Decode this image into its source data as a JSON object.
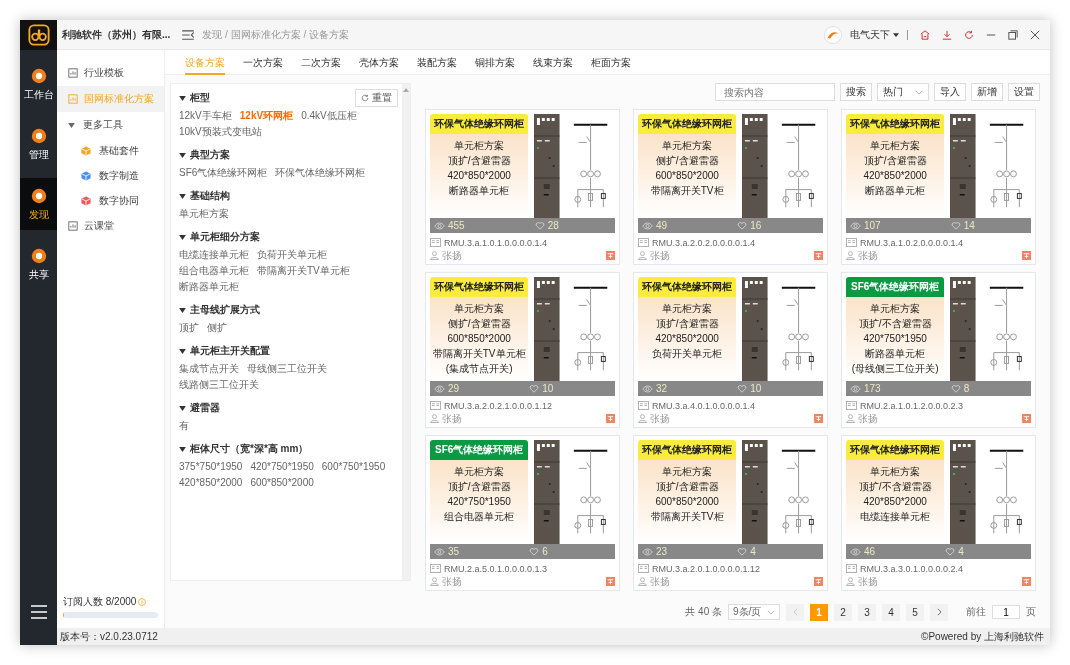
{
  "rail": {
    "items": [
      {
        "label": "工作台",
        "selected": false
      },
      {
        "label": "管理",
        "selected": false
      },
      {
        "label": "发现",
        "selected": true
      },
      {
        "label": "共享",
        "selected": false
      }
    ]
  },
  "app_title": "利驰软件（苏州）有限...",
  "breadcrumb": "发现 / 国网标准化方案 / 设备方案",
  "user": {
    "name": "电气天下"
  },
  "menu": {
    "items": [
      {
        "label": "行业模板",
        "selected": false
      },
      {
        "label": "国网标准化方案",
        "selected": true
      },
      {
        "label": "更多工具",
        "selected": false,
        "expanded": true,
        "children": [
          {
            "label": "基础套件",
            "color": "#f5a623"
          },
          {
            "label": "数字制造",
            "color": "#4a8ef0"
          },
          {
            "label": "数字协同",
            "color": "#f05a5a"
          }
        ]
      },
      {
        "label": "云课堂",
        "selected": false
      }
    ]
  },
  "subscription": {
    "label": "订阅人数 8/2000",
    "level": 0.004
  },
  "version": "版本号：v2.0.23.0712",
  "tabs": [
    {
      "label": "设备方案",
      "selected": true
    },
    {
      "label": "一次方案",
      "selected": false
    },
    {
      "label": "二次方案",
      "selected": false
    },
    {
      "label": "壳体方案",
      "selected": false
    },
    {
      "label": "装配方案",
      "selected": false
    },
    {
      "label": "铜排方案",
      "selected": false
    },
    {
      "label": "线束方案",
      "selected": false
    },
    {
      "label": "柜面方案",
      "selected": false
    }
  ],
  "filters": {
    "reset": "重置",
    "groups": [
      {
        "title": "柜型",
        "options": [
          {
            "label": "12kV手车柜",
            "selected": false
          },
          {
            "label": "12kV环网柜",
            "selected": true
          },
          {
            "label": "0.4kV低压柜",
            "selected": false
          },
          {
            "label": "10kV预装式变电站",
            "selected": false
          }
        ]
      },
      {
        "title": "典型方案",
        "options": [
          {
            "label": "SF6气体绝缘环网柜",
            "selected": false
          },
          {
            "label": "环保气体绝缘环网柜",
            "selected": false
          }
        ]
      },
      {
        "title": "基础结构",
        "options": [
          {
            "label": "单元柜方案",
            "selected": false
          }
        ]
      },
      {
        "title": "单元柜细分方案",
        "options": [
          {
            "label": "电缆连接单元柜",
            "selected": false
          },
          {
            "label": "负荷开关单元柜",
            "selected": false
          },
          {
            "label": "组合电器单元柜",
            "selected": false
          },
          {
            "label": "带隔离开关TV单元柜",
            "selected": false
          },
          {
            "label": "断路器单元柜",
            "selected": false
          }
        ]
      },
      {
        "title": "主母线扩展方式",
        "options": [
          {
            "label": "顶扩",
            "selected": false
          },
          {
            "label": "侧扩",
            "selected": false
          }
        ]
      },
      {
        "title": "单元柜主开关配置",
        "options": [
          {
            "label": "集成节点开关",
            "selected": false
          },
          {
            "label": "母线侧三工位开关",
            "selected": false
          },
          {
            "label": "线路侧三工位开关",
            "selected": false
          }
        ]
      },
      {
        "title": "避雷器",
        "options": [
          {
            "label": "有",
            "selected": false
          }
        ]
      },
      {
        "title": "柜体尺寸（宽*深*高 mm）",
        "options": [
          {
            "label": "375*750*1950",
            "selected": false
          },
          {
            "label": "420*750*1950",
            "selected": false
          },
          {
            "label": "600*750*1950",
            "selected": false
          },
          {
            "label": "420*850*2000",
            "selected": false
          },
          {
            "label": "600*850*2000",
            "selected": false
          }
        ]
      }
    ]
  },
  "toolbar": {
    "search_placeholder": "搜索内容",
    "search_button": "搜索",
    "sort": "热门",
    "buttons": [
      "导入",
      "新增",
      "设置"
    ]
  },
  "cards": [
    {
      "title": "环保气体绝缘环网柜",
      "color": "#f9ec3c",
      "lines": [
        "单元柜方案",
        "顶扩/含避雷器",
        "420*850*2000",
        "断路器单元柜"
      ],
      "views": "455",
      "likes": "28",
      "code": "RMU.3.a.1.0.1.0.0.0.0.1.4",
      "author": "张扬"
    },
    {
      "title": "环保气体绝缘环网柜",
      "color": "#f9ec3c",
      "lines": [
        "单元柜方案",
        "侧扩/含避雷器",
        "600*850*2000",
        "带隔离开关TV柜"
      ],
      "views": "49",
      "likes": "16",
      "code": "RMU.3.a.2.0.2.0.0.0.0.1.4",
      "author": "张扬"
    },
    {
      "title": "环保气体绝缘环网柜",
      "color": "#f9ec3c",
      "lines": [
        "单元柜方案",
        "顶扩/含避雷器",
        "420*850*2000",
        "断路器单元柜"
      ],
      "views": "107",
      "likes": "14",
      "code": "RMU.3.a.1.0.2.0.0.0.0.1.4",
      "author": "张扬"
    },
    {
      "title": "环保气体绝缘环网柜",
      "color": "#f9ec3c",
      "lines": [
        "单元柜方案",
        "侧扩/含避雷器",
        "600*850*2000",
        "带隔离开关TV单元柜",
        "(集成节点开关)"
      ],
      "views": "29",
      "likes": "10",
      "code": "RMU.3.a.2.0.2.1.0.0.0.1.12",
      "author": "张扬"
    },
    {
      "title": "环保气体绝缘环网柜",
      "color": "#f9ec3c",
      "lines": [
        "单元柜方案",
        "顶扩/含避雷器",
        "420*850*2000",
        "负荷开关单元柜"
      ],
      "views": "32",
      "likes": "10",
      "code": "RMU.3.a.4.0.1.0.0.0.0.1.4",
      "author": "张扬"
    },
    {
      "title": "SF6气体绝缘环网柜",
      "color": "#0a9a44",
      "lines": [
        "单元柜方案",
        "顶扩/不含避雷器",
        "420*750*1950",
        "断路器单元柜",
        "(母线侧三工位开关)"
      ],
      "views": "173",
      "likes": "8",
      "code": "RMU.2.a.1.0.1.2.0.0.0.2.3",
      "author": "张扬"
    },
    {
      "title": "SF6气体绝缘环网柜",
      "color": "#0a9a44",
      "lines": [
        "单元柜方案",
        "顶扩/含避雷器",
        "420*750*1950",
        "组合电器单元柜"
      ],
      "views": "35",
      "likes": "6",
      "code": "RMU.2.a.5.0.1.0.0.0.0.1.3",
      "author": "张扬"
    },
    {
      "title": "环保气体绝缘环网柜",
      "color": "#f9ec3c",
      "lines": [
        "单元柜方案",
        "顶扩/含避雷器",
        "600*850*2000",
        "带隔离开关TV柜"
      ],
      "views": "23",
      "likes": "4",
      "code": "RMU.3.a.2.0.1.0.0.0.0.1.12",
      "author": "张扬"
    },
    {
      "title": "环保气体绝缘环网柜",
      "color": "#f9ec3c",
      "lines": [
        "单元柜方案",
        "顶扩/不含避雷器",
        "420*850*2000",
        "电缆连接单元柜"
      ],
      "views": "46",
      "likes": "4",
      "code": "RMU.3.a.3.0.1.0.0.0.0.2.4",
      "author": "张扬"
    }
  ],
  "pagination": {
    "total": "共 40 条",
    "page_size": "9条/页",
    "pages": [
      {
        "label": "1",
        "selected": true
      },
      {
        "label": "2",
        "selected": false
      },
      {
        "label": "3",
        "selected": false
      },
      {
        "label": "4",
        "selected": false
      },
      {
        "label": "5",
        "selected": false
      }
    ],
    "goto_label": "前往",
    "goto_value": "1",
    "goto_suffix": "页"
  },
  "footer": "©Powered by 上海利驰软件"
}
